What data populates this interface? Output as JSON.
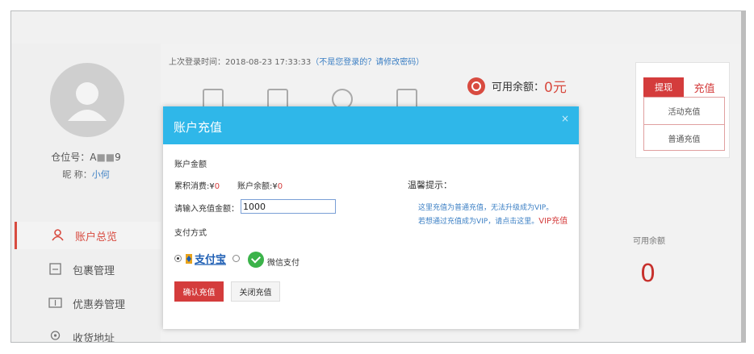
{
  "user": {
    "uid_label": "仓位号：A",
    "uid_mask": "■■",
    "uid_tail": "9",
    "nick_label": "昵 称：",
    "nick_value": "小何"
  },
  "sidebar": {
    "items": [
      {
        "label": "账户总览",
        "icon": "user-icon",
        "active": true
      },
      {
        "label": "包裹管理",
        "icon": "package-icon",
        "active": false
      },
      {
        "label": "优惠券管理",
        "icon": "coupon-icon",
        "active": false
      },
      {
        "label": "收货地址",
        "icon": "location-icon",
        "active": false
      }
    ]
  },
  "main": {
    "last_login_prefix": "上次登录时间：2018-08-23 17:33:33",
    "last_login_link": "（不是您登录的？请修改密码）",
    "balance_label": "可用余额：",
    "balance_value": "0元",
    "available_label": "可用余额",
    "available_value": "0"
  },
  "recharge_panel": {
    "tab_withdraw": "提现",
    "tab_recharge": "充值",
    "menu": [
      "活动充值",
      "普通充值"
    ]
  },
  "modal": {
    "title": "账户充值",
    "close": "×",
    "section_amount": "账户金额",
    "total_spent_label": "累积消费:¥",
    "total_spent_value": "0",
    "account_balance_label": "账户余额:¥",
    "account_balance_value": "0",
    "input_label": "请输入充值金额：",
    "input_value": "1000",
    "pay_method_label": "支付方式",
    "alipay_label": "支付宝",
    "wechat_label": "微信支付",
    "tips_title": "温馨提示：",
    "tip_line1": "这里充值为普通充值，无法升级成为VIP。",
    "tip_line2": "若想通过充值成为VIP，请点击这里。",
    "tip_vip": "VIP充值",
    "confirm_button": "确认充值",
    "close_button": "关闭充值"
  },
  "colors": {
    "accent_red": "#d43c3c",
    "header_blue": "#2fb7e9",
    "link_blue": "#3b7fc4"
  }
}
